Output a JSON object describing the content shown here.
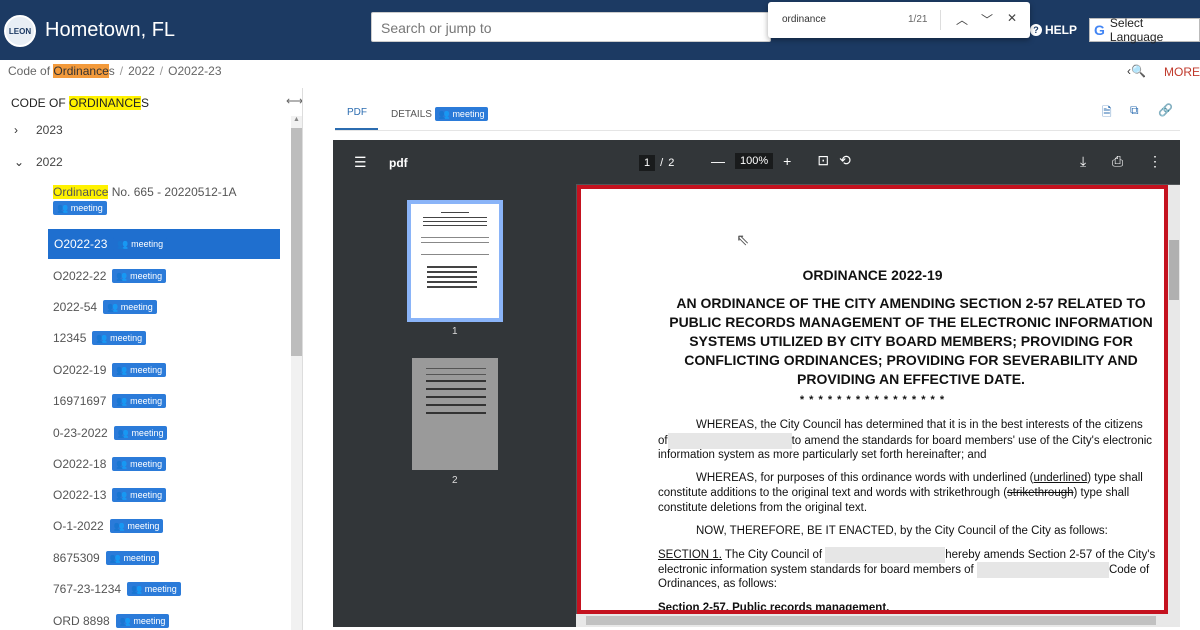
{
  "header": {
    "seal_text": "LEON",
    "title": "Hometown, FL",
    "search_placeholder": "Search or jump to",
    "help": "HELP",
    "language": "Select Language"
  },
  "find": {
    "query": "ordinance",
    "count": "1/21"
  },
  "breadcrumb": {
    "c1_pre": "Code of ",
    "c1_hl": "Ordinance",
    "c1_post": "s",
    "c2": "2022",
    "c3": "O2022-23"
  },
  "more": "MORE",
  "sidebar": {
    "title_pre": "CODE OF ",
    "title_hl": "ORDINANCE",
    "title_post": "S",
    "nodes": [
      "2023",
      "2022"
    ],
    "items": [
      {
        "hl": "Ordinance",
        "label": " No. 665 - 20220512-1A",
        "badge": "meeting"
      },
      {
        "label": "O2022-23",
        "badge": "meeting"
      },
      {
        "label": "O2022-22",
        "badge": "meeting"
      },
      {
        "label": "2022-54",
        "badge": "meeting"
      },
      {
        "label": "12345",
        "badge": "meeting"
      },
      {
        "label": "O2022-19",
        "badge": "meeting"
      },
      {
        "label": "16971697",
        "badge": "meeting"
      },
      {
        "label": "0-23-2022",
        "badge": "meeting"
      },
      {
        "label": "O2022-18",
        "badge": "meeting"
      },
      {
        "label": "O2022-13",
        "badge": "meeting"
      },
      {
        "label": "O-1-2022",
        "badge": "meeting"
      },
      {
        "label": "8675309",
        "badge": "meeting"
      },
      {
        "label": "767-23-1234",
        "badge": "meeting"
      },
      {
        "label": "ORD 8898",
        "badge": "meeting"
      }
    ]
  },
  "tabs": {
    "pdf": "PDF",
    "details": "DETAILS",
    "details_badge": "meeting"
  },
  "viewer": {
    "filename": "pdf",
    "page": "1",
    "pages": "2",
    "zoom": "100%",
    "thumb_labels": [
      "1",
      "2"
    ]
  },
  "document": {
    "title": "ORDINANCE 2022-19",
    "subtitle": "AN ORDINANCE OF THE CITY AMENDING SECTION 2-57 RELATED TO PUBLIC RECORDS MANAGEMENT OF THE ELECTRONIC INFORMATION SYSTEMS UTILIZED BY CITY BOARD MEMBERS; PROVIDING FOR CONFLICTING ORDINANCES; PROVIDING FOR SEVERABILITY AND PROVIDING AN EFFECTIVE DATE.",
    "stars": "* * * * * * * * * * * * * * * *",
    "p1a": "WHEREAS, the City Council has determined that it is in the best interests of the citizens",
    "p1b_pre": "of",
    "p1b_post": "to amend the standards for board members' use of the City's electronic",
    "p1c": "information system as more particularly set forth hereinafter; and",
    "p2a_pre": "WHEREAS, for purposes of this ordinance words with underlined (",
    "p2a_u": "underlined",
    "p2a_post": ") type shall",
    "p2b_pre": "constitute additions to the original text and words with strikethrough (",
    "p2b_s": "strikethrough",
    "p2b_post": ") type shall",
    "p2c": "constitute deletions from the original text.",
    "p3": "NOW, THEREFORE, BE IT ENACTED, by the City Council of the City as follows:",
    "p4_sec": "SECTION 1.",
    "p4a_mid": " The City Council of",
    "p4a_post": "hereby amends Section 2-57 of the City's",
    "p4b_pre": "electronic information system standards for board members of",
    "p4b_post": "Code of",
    "p4c": "Ordinances, as follows:",
    "p5": "Section 2-57. Public records management."
  }
}
